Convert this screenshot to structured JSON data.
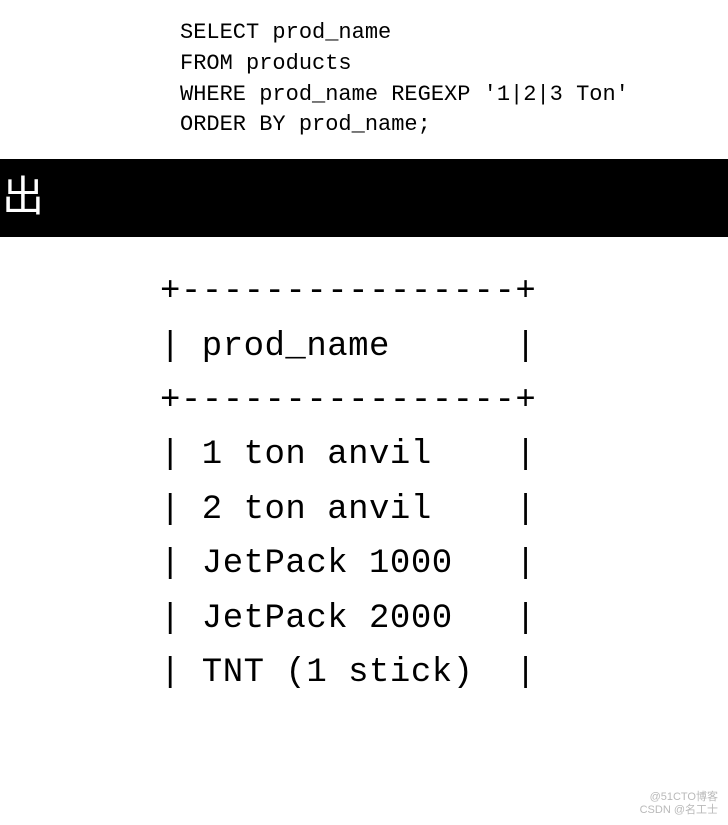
{
  "sql": {
    "line1": "SELECT prod_name",
    "line2": "FROM products",
    "line3": "WHERE prod_name REGEXP '1|2|3 Ton'",
    "line4": "ORDER BY prod_name;"
  },
  "bar": {
    "text": "出"
  },
  "result": {
    "border_top": "+----------------+",
    "header": "| prod_name      |",
    "border_mid": "+----------------+",
    "row1": "| 1 ton anvil    |",
    "row2": "| 2 ton anvil    |",
    "row3": "| JetPack 1000   |",
    "row4": "| JetPack 2000   |",
    "row5": "| TNT (1 stick)  |"
  },
  "watermark": {
    "line1": "@51CTO博客",
    "line2": "CSDN @名工士"
  },
  "chart_data": {
    "type": "table",
    "title": "SQL REGEXP query result",
    "query": "SELECT prod_name FROM products WHERE prod_name REGEXP '1|2|3 Ton' ORDER BY prod_name;",
    "columns": [
      "prod_name"
    ],
    "rows": [
      [
        "1 ton anvil"
      ],
      [
        "2 ton anvil"
      ],
      [
        "JetPack 1000"
      ],
      [
        "JetPack 2000"
      ],
      [
        "TNT (1 stick)"
      ]
    ]
  }
}
